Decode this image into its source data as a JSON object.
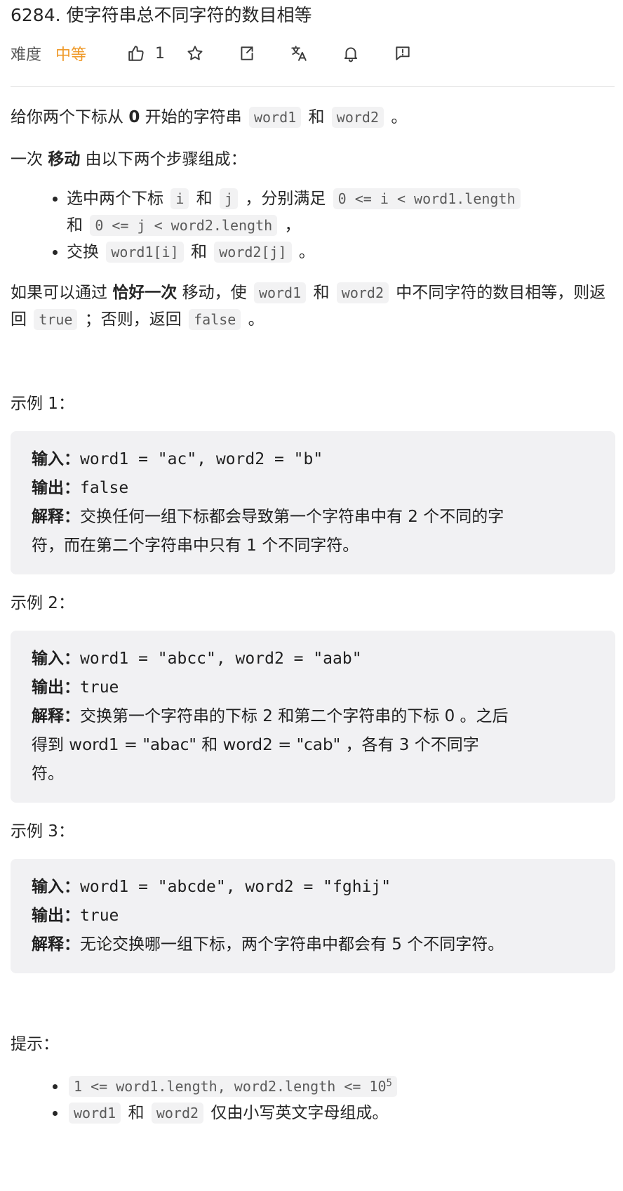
{
  "problem": {
    "title": "6284. 使字符串总不同字符的数目相等",
    "difficulty_label": "难度",
    "difficulty_value": "中等",
    "like_count": "1"
  },
  "toolbar": {
    "icons": [
      "thumbs-up-icon",
      "star-icon",
      "share-icon",
      "translate-icon",
      "bell-icon",
      "feedback-icon"
    ]
  },
  "description": {
    "p1_before": "给你两个下标从 ",
    "p1_bold": "0",
    "p1_mid": " 开始的字符串 ",
    "p1_code1": "word1",
    "p1_and": " 和 ",
    "p1_code2": "word2",
    "p1_end": " 。",
    "p2_before": "一次 ",
    "p2_bold": "移动",
    "p2_after": " 由以下两个步骤组成：",
    "li1_a": "选中两个下标 ",
    "li1_code_i": "i",
    "li1_and": " 和 ",
    "li1_code_j": "j",
    "li1_b": " ，分别满足 ",
    "li1_code_c1": "0 <= i < word1.length",
    "li1_and2": " 和 ",
    "li1_code_c2": "0 <= j < word2.length",
    "li1_end": " ，",
    "li2_a": "交换 ",
    "li2_code1": "word1[i]",
    "li2_and": " 和 ",
    "li2_code2": "word2[j]",
    "li2_end": " 。",
    "p3_a": "如果可以通过 ",
    "p3_bold": "恰好一次",
    "p3_b": " 移动，使 ",
    "p3_code1": "word1",
    "p3_and": " 和 ",
    "p3_code2": "word2",
    "p3_c": " 中不同字符的数目相等，则返回 ",
    "p3_true": "true",
    "p3_d": " ；否则，返回 ",
    "p3_false": "false",
    "p3_end": " 。"
  },
  "examples": [
    {
      "title": "示例 1：",
      "input_label": "输入：",
      "input_value": "word1 = \"ac\", word2 = \"b\"",
      "output_label": "输出：",
      "output_value": "false",
      "explain_label": "解释：",
      "explain_line1": "交换任何一组下标都会导致第一个字符串中有 2 个不同的字",
      "explain_line2": "符，而在第二个字符串中只有 1 个不同字符。"
    },
    {
      "title": "示例 2：",
      "input_label": "输入：",
      "input_value": "word1 = \"abcc\", word2 = \"aab\"",
      "output_label": "输出：",
      "output_value": "true",
      "explain_label": "解释：",
      "explain_line1": "交换第一个字符串的下标 2 和第二个字符串的下标 0 。之后",
      "explain_line2": "得到 word1 = \"abac\" 和 word2 = \"cab\" ，各有 3 个不同字",
      "explain_line3": "符。"
    },
    {
      "title": "示例 3：",
      "input_label": "输入：",
      "input_value": "word1 = \"abcde\", word2 = \"fghij\"",
      "output_label": "输出：",
      "output_value": "true",
      "explain_label": "解释：",
      "explain_line1": "无论交换哪一组下标，两个字符串中都会有 5 个不同字符。"
    }
  ],
  "constraints": {
    "title": "提示：",
    "c1_code": "1 <= word1.length, word2.length <= 10",
    "c1_exp": "5",
    "c2_code1": "word1",
    "c2_and": " 和 ",
    "c2_code2": "word2",
    "c2_text": " 仅由小写英文字母组成。"
  }
}
